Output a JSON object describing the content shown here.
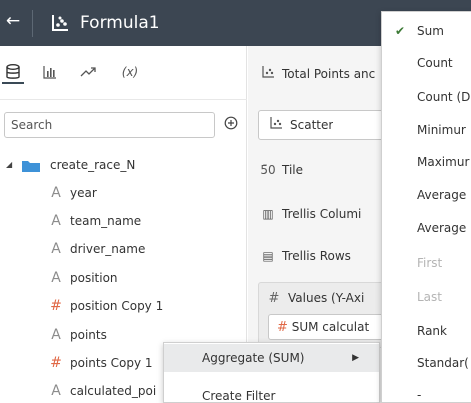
{
  "header": {
    "back_icon": "back-arrow-icon",
    "title": "Formula1"
  },
  "left_panel": {
    "tabs": [
      {
        "icon": "data-cylinder-icon",
        "label": "",
        "active": true
      },
      {
        "icon": "bar-chart-icon",
        "label": ""
      },
      {
        "icon": "trend-line-icon",
        "label": ""
      },
      {
        "icon": "calculation-icon",
        "label": "(x)"
      }
    ],
    "search": {
      "placeholder": "Search"
    },
    "tree": {
      "dataset": "create_race_N",
      "items": [
        {
          "type": "A",
          "label": "year"
        },
        {
          "type": "A",
          "label": "team_name"
        },
        {
          "type": "A",
          "label": "driver_name"
        },
        {
          "type": "A",
          "label": "position"
        },
        {
          "type": "#",
          "label": "position Copy 1"
        },
        {
          "type": "A",
          "label": "points"
        },
        {
          "type": "#",
          "label": "points Copy 1"
        },
        {
          "type": "A",
          "label": "calculated_poi"
        }
      ]
    }
  },
  "mid_panel": {
    "viz_title": "Total Points anc",
    "chart_type": "Scatter",
    "rows": [
      {
        "icon": "tile-icon",
        "glyph": "5̄0",
        "label": "Tile"
      },
      {
        "icon": "trellis-columns-icon",
        "glyph": "▥",
        "label": "Trellis Columi"
      },
      {
        "icon": "trellis-rows-icon",
        "glyph": "▤",
        "label": "Trellis Rows"
      }
    ],
    "values_label": "Values (Y-Axi",
    "values_pill": "SUM calculat"
  },
  "context_menu": {
    "items": [
      {
        "label": "Aggregate (SUM)",
        "has_submenu": true
      },
      {
        "label": "Create Filter"
      }
    ]
  },
  "aggregate_menu": {
    "items": [
      {
        "label": "Sum",
        "checked": true
      },
      {
        "label": "Count"
      },
      {
        "label": "Count (D"
      },
      {
        "label": "Minimur"
      },
      {
        "label": "Maximur"
      },
      {
        "label": "Average"
      },
      {
        "label": "Average"
      },
      {
        "label": "First",
        "disabled": true
      },
      {
        "label": "Last",
        "disabled": true
      },
      {
        "label": "Rank"
      },
      {
        "label": "Standar("
      },
      {
        "label": "-"
      }
    ],
    "check_glyph": "✔",
    "check_color": "#3d7a36"
  },
  "colors": {
    "header_bg": "#3c4652",
    "measure": "#e06846",
    "folder": "#3e92d8"
  }
}
